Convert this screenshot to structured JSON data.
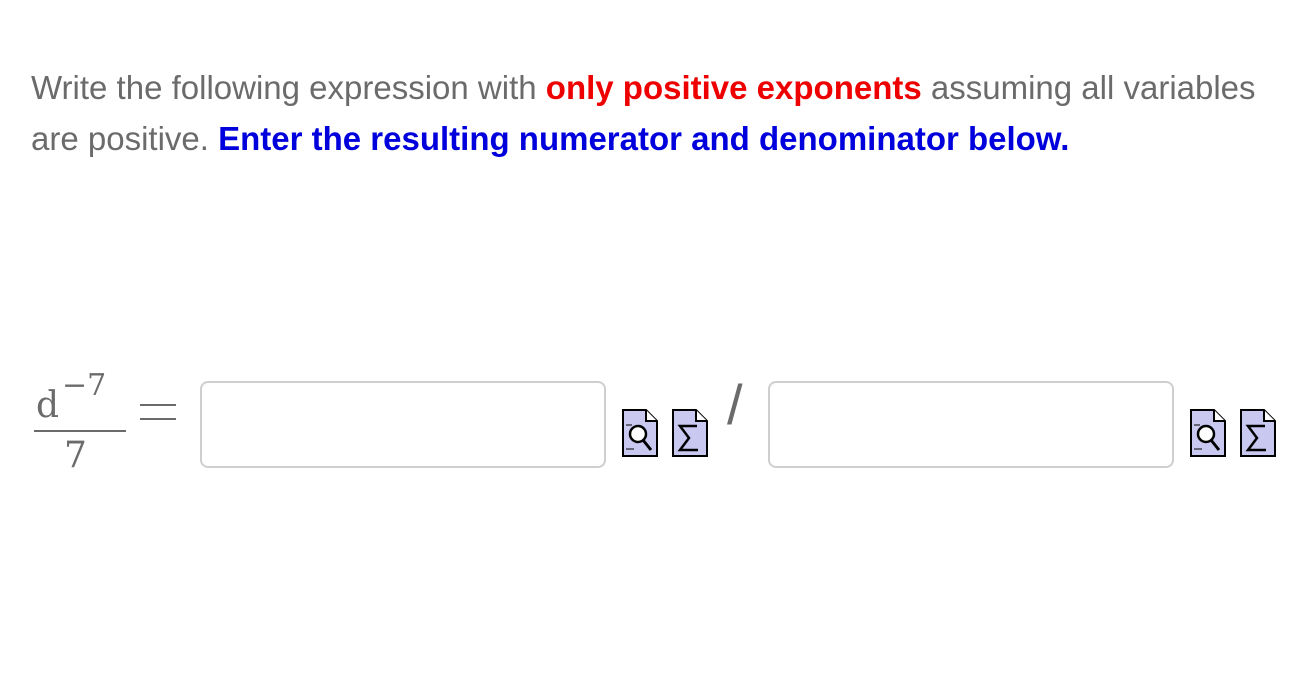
{
  "question": {
    "text_before": "Write the following expression with ",
    "highlight_red": "only positive exponents",
    "text_middle": " assuming all variables are positive. ",
    "highlight_blue": "Enter the resulting numerator and denominator below."
  },
  "expression": {
    "numerator_base": "d",
    "numerator_exponent": "−7",
    "denominator": "7",
    "equals": "="
  },
  "answer": {
    "numerator_value": "",
    "numerator_placeholder": "",
    "separator": "/",
    "denominator_value": "",
    "denominator_placeholder": ""
  },
  "icons": {
    "preview": "preview-magnifier-icon",
    "equation_editor": "equation-editor-sigma-icon"
  },
  "colors": {
    "emphasis_red": "#ee0000",
    "emphasis_blue": "#0000dd",
    "body_text": "#6b6b6b",
    "icon_fill": "#c8c8f0"
  }
}
